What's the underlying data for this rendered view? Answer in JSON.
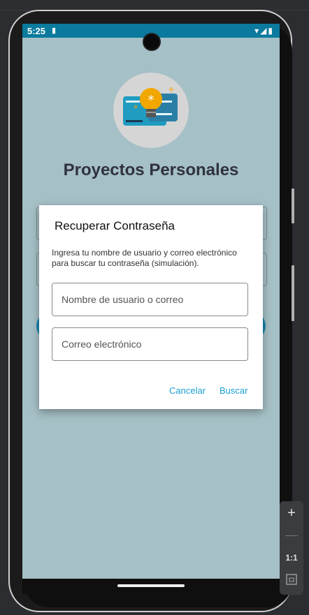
{
  "status_bar": {
    "time": "5:25",
    "icons": "▾◢▮"
  },
  "app": {
    "title": "Proyectos Personales"
  },
  "dialog": {
    "title": "Recuperar Contraseña",
    "message": "Ingresa tu nombre de usuario y correo electrónico para buscar tu contraseña (simulación).",
    "username_placeholder": "Nombre de usuario o correo",
    "email_placeholder": "Correo electrónico",
    "cancel_label": "Cancelar",
    "search_label": "Buscar"
  },
  "emulator_toolbar": {
    "zoom_in": "+",
    "zoom_out": "−",
    "ratio": "1:1"
  },
  "colors": {
    "status_bar": "#0b7a9e",
    "screen_bg": "#a5c0c6",
    "accent": "#1a9fd1"
  }
}
